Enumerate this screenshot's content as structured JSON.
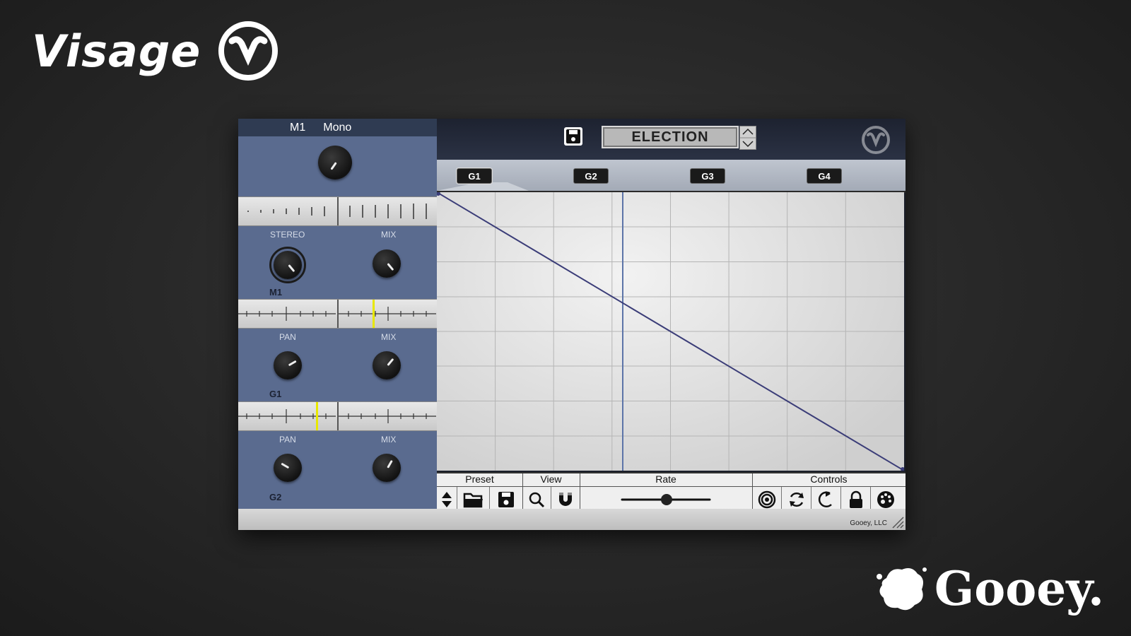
{
  "brand": {
    "name": "Visage",
    "company": "Gooey."
  },
  "left_panel": {
    "header_left": "M1",
    "header_right": "Mono",
    "sections": [
      {
        "label_left": "STEREO",
        "label_right": "MIX",
        "sub_label": "M1"
      },
      {
        "label_left": "PAN",
        "label_right": "MIX",
        "sub_label": "G1"
      },
      {
        "label_left": "PAN",
        "label_right": "MIX",
        "sub_label": "G2"
      }
    ]
  },
  "header": {
    "preset_name": "ELECTION"
  },
  "groups": [
    "G1",
    "G2",
    "G3",
    "G4"
  ],
  "toolbar": {
    "preset_label": "Preset",
    "view_label": "View",
    "rate_label": "Rate",
    "controls_label": "Controls"
  },
  "footer": {
    "credit": "Gooey, LLC"
  },
  "colors": {
    "panel": "#5a6b8f",
    "curve": "#3b3d78",
    "playhead": "#5c74a8",
    "marker": "#e8e800"
  },
  "icons": [
    "save-icon",
    "up-down-arrows-icon",
    "folder-icon",
    "save-icon",
    "magnifier-icon",
    "magnet-icon",
    "target-icon",
    "refresh-icon",
    "undo-icon",
    "lock-icon",
    "palette-icon"
  ]
}
